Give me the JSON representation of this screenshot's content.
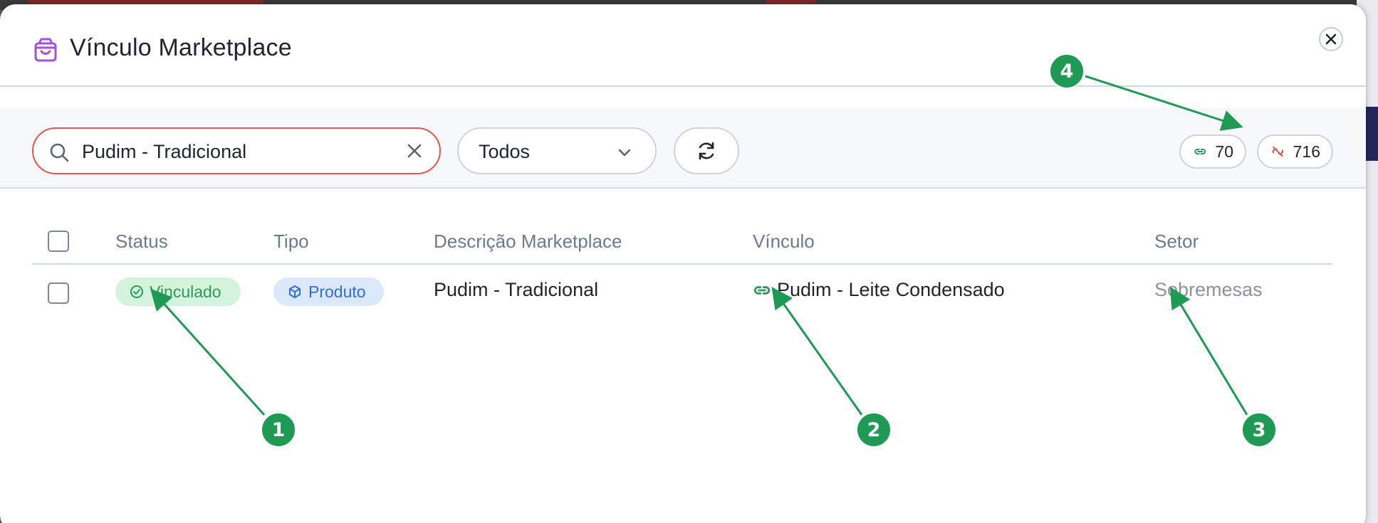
{
  "dialog": {
    "title": "Vínculo Marketplace",
    "icon": "shopping-bag-icon",
    "accent": "#a64fd9"
  },
  "toolbar": {
    "search_value": "Pudim - Tradicional",
    "filter_value": "Todos",
    "linked_count": "70",
    "unlinked_count": "716"
  },
  "table": {
    "headers": [
      "Status",
      "Tipo",
      "Descrição Marketplace",
      "Vínculo",
      "Setor"
    ],
    "rows": [
      {
        "status": "Vinculado",
        "tipo": "Produto",
        "descricao": "Pudim - Tradicional",
        "vinculo": "Pudim - Leite Condensado",
        "setor": "Sobremesas"
      }
    ]
  },
  "annotations": [
    "1",
    "2",
    "3",
    "4"
  ],
  "colors": {
    "linked_green": "#2f9a57",
    "unlinked_red": "#e2574c",
    "tipo_blue": "#2f6fdc",
    "marker_green": "#1e9a55"
  }
}
